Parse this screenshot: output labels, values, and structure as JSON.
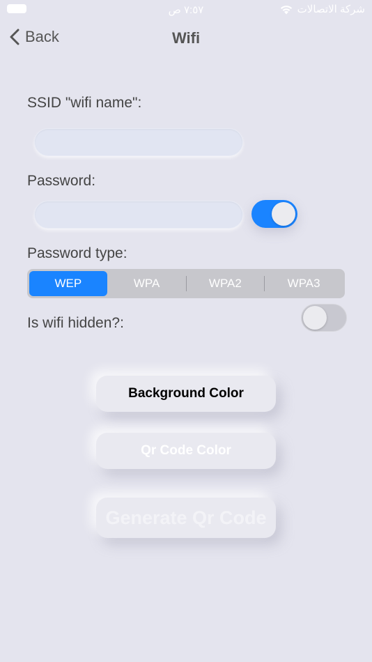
{
  "status_bar": {
    "time": "٧:٥٧ ص",
    "carrier": "شركة الاتصالات"
  },
  "nav": {
    "back_label": "Back",
    "title": "Wifi"
  },
  "form": {
    "ssid_label": "SSID \"wifi name\":",
    "ssid_value": "",
    "password_label": "Password:",
    "password_value": "",
    "password_toggle_on": true,
    "password_type_label": "Password type:",
    "password_types": [
      "WEP",
      "WPA",
      "WPA2",
      "WPA3"
    ],
    "selected_password_type": "WEP",
    "hidden_label": "Is wifi hidden?:",
    "hidden_toggle_on": false
  },
  "buttons": {
    "background_color": "Background Color",
    "qr_code_color": "Qr Code Color",
    "generate": "Generate Qr Code"
  },
  "colors": {
    "accent": "#1a84ff",
    "background": "#e4e4ee"
  }
}
